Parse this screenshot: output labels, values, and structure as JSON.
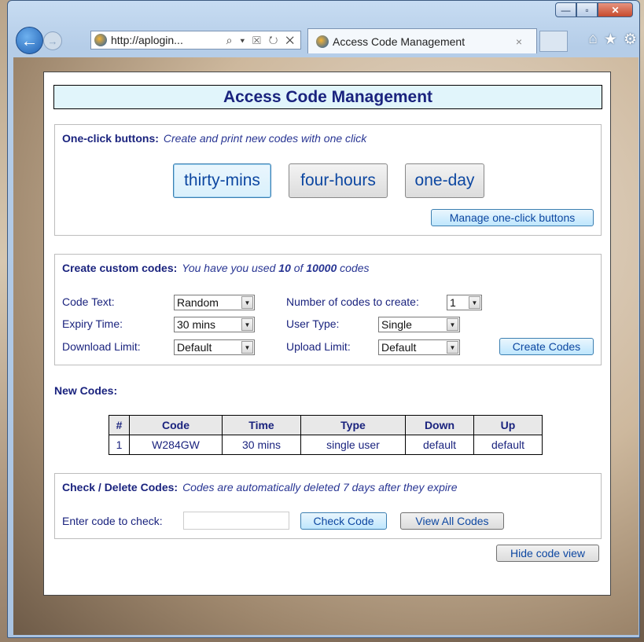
{
  "browser": {
    "address": "http://aplogin...",
    "address_tools": "⌕ ▾ ☒ ↻ ✕",
    "tab_title": "Access Code Management",
    "tab_close": "×",
    "window_controls": {
      "minimize": "—",
      "maximize": "▫",
      "close": "✕"
    }
  },
  "page": {
    "title": "Access Code Management",
    "one_click": {
      "heading": "One-click buttons:",
      "subtitle": "Create and print new codes with one click",
      "buttons": [
        "thirty-mins",
        "four-hours",
        "one-day"
      ],
      "manage_label": "Manage one-click buttons"
    },
    "custom": {
      "heading": "Create custom codes:",
      "subtitle_prefix": "You have you used",
      "used": "10",
      "of": "of",
      "total": "10000",
      "subtitle_suffix": "codes",
      "code_text_label": "Code Text:",
      "code_text_value": "Random",
      "expiry_label": "Expiry Time:",
      "expiry_value": "30 mins",
      "download_label": "Download Limit:",
      "download_value": "Default",
      "number_label": "Number of codes to create:",
      "number_value": "1",
      "user_type_label": "User Type:",
      "user_type_value": "Single",
      "upload_label": "Upload Limit:",
      "upload_value": "Default",
      "create_label": "Create Codes"
    },
    "new_codes": {
      "heading": "New Codes:",
      "columns": [
        "#",
        "Code",
        "Time",
        "Type",
        "Down",
        "Up"
      ],
      "rows": [
        [
          "1",
          "W284GW",
          "30 mins",
          "single user",
          "default",
          "default"
        ]
      ]
    },
    "check": {
      "heading": "Check / Delete Codes:",
      "subtitle": "Codes are automatically deleted 7 days after they expire",
      "input_label": "Enter code to check:",
      "input_value": "",
      "check_label": "Check Code",
      "view_all_label": "View All Codes"
    },
    "hide_label": "Hide code view"
  },
  "colors": {
    "heading_text": "#1a237e",
    "title_bg": "#e1f5fb",
    "button_text": "#0d47a1"
  }
}
